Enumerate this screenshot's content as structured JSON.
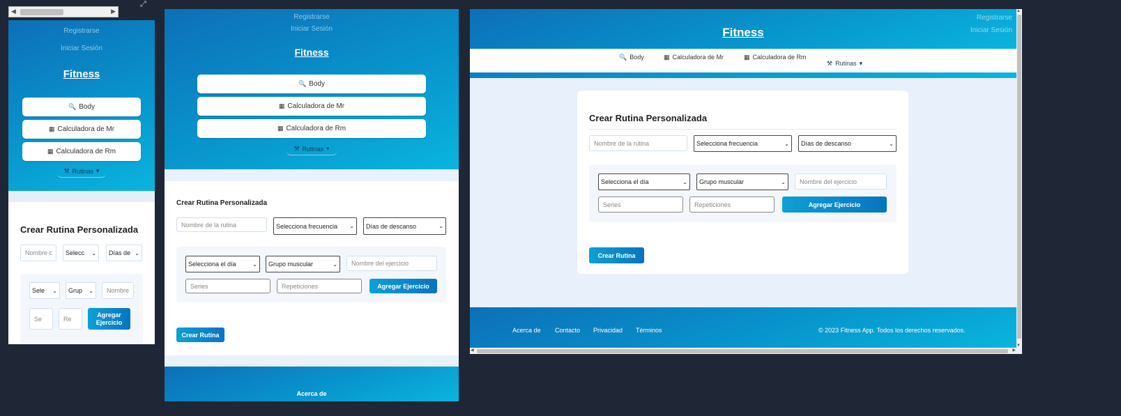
{
  "nav": {
    "register": "Registrarse",
    "login": "Iniciar Sesión",
    "brand": "Fitness",
    "body": "Body",
    "mr": "Calculadora de Mr",
    "rm": "Calculadora de Rm",
    "routines": "Rutinas"
  },
  "form": {
    "title": "Crear Rutina Personalizada",
    "routine_name_placeholder": "Nombre de la rutina",
    "frequency": "Selecciona frecuencia",
    "rest_days": "Días de descanso",
    "day": "Selecciona el día",
    "muscle_group": "Grupo muscular",
    "exercise_placeholder": "Nombre del ejercicio",
    "series_placeholder": "Series",
    "reps_placeholder": "Repeticiones",
    "add_exercise": "Agregar Ejercicio",
    "create": "Crear Rutina"
  },
  "mobile": {
    "routine_name": "Nombre c",
    "frequency": "Selecc",
    "rest_days": "Días de",
    "day": "Sele",
    "muscle": "Grup",
    "exercise": "Nombre",
    "series": "Se",
    "reps": "Re",
    "add_line1": "Agregar",
    "add_line2": "Ejercicio"
  },
  "footer": {
    "about": "Acerca de",
    "contact": "Contacto",
    "privacy": "Privacidad",
    "terms": "Términos",
    "copyright": "© 2023 Fitness App. Todos los derechos reservados."
  },
  "icons": {
    "body": "magnifier-icon",
    "calculator": "calculator-icon",
    "routines": "dumbbell-icon",
    "expand": "expand-icon"
  }
}
